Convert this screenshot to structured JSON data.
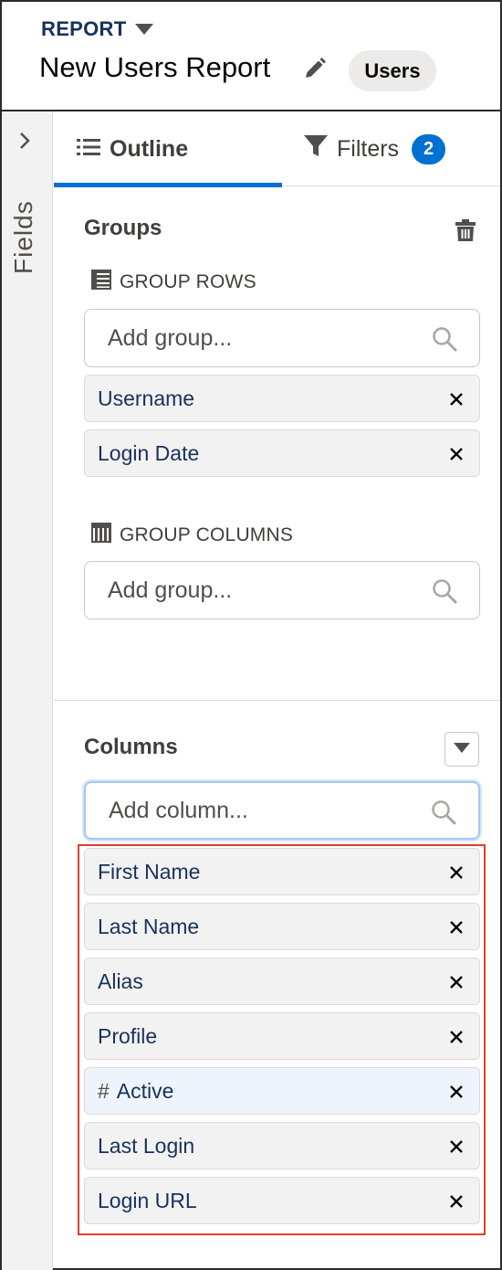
{
  "header": {
    "object_label": "REPORT",
    "title": "New Users Report",
    "type_badge": "Users"
  },
  "fields_rail": {
    "label": "Fields"
  },
  "tabs": [
    {
      "label": "Outline",
      "active": true
    },
    {
      "label": "Filters",
      "badge": "2"
    }
  ],
  "groups": {
    "title": "Groups",
    "rows": {
      "heading": "GROUP ROWS",
      "search_placeholder": "Add group...",
      "items": [
        "Username",
        "Login Date"
      ]
    },
    "columns": {
      "heading": "GROUP COLUMNS",
      "search_placeholder": "Add group..."
    }
  },
  "columns": {
    "title": "Columns",
    "search_placeholder": "Add column...",
    "items": [
      {
        "label": "First Name"
      },
      {
        "label": "Last Name"
      },
      {
        "label": "Alias"
      },
      {
        "label": "Profile"
      },
      {
        "label": "Active",
        "prefix": "#"
      },
      {
        "label": "Last Login"
      },
      {
        "label": "Login URL"
      }
    ]
  },
  "colors": {
    "brand_blue": "#0070d2",
    "title_navy": "#16325c",
    "highlight_border": "#e43d2c",
    "pill_background": "#f3f2f2"
  }
}
